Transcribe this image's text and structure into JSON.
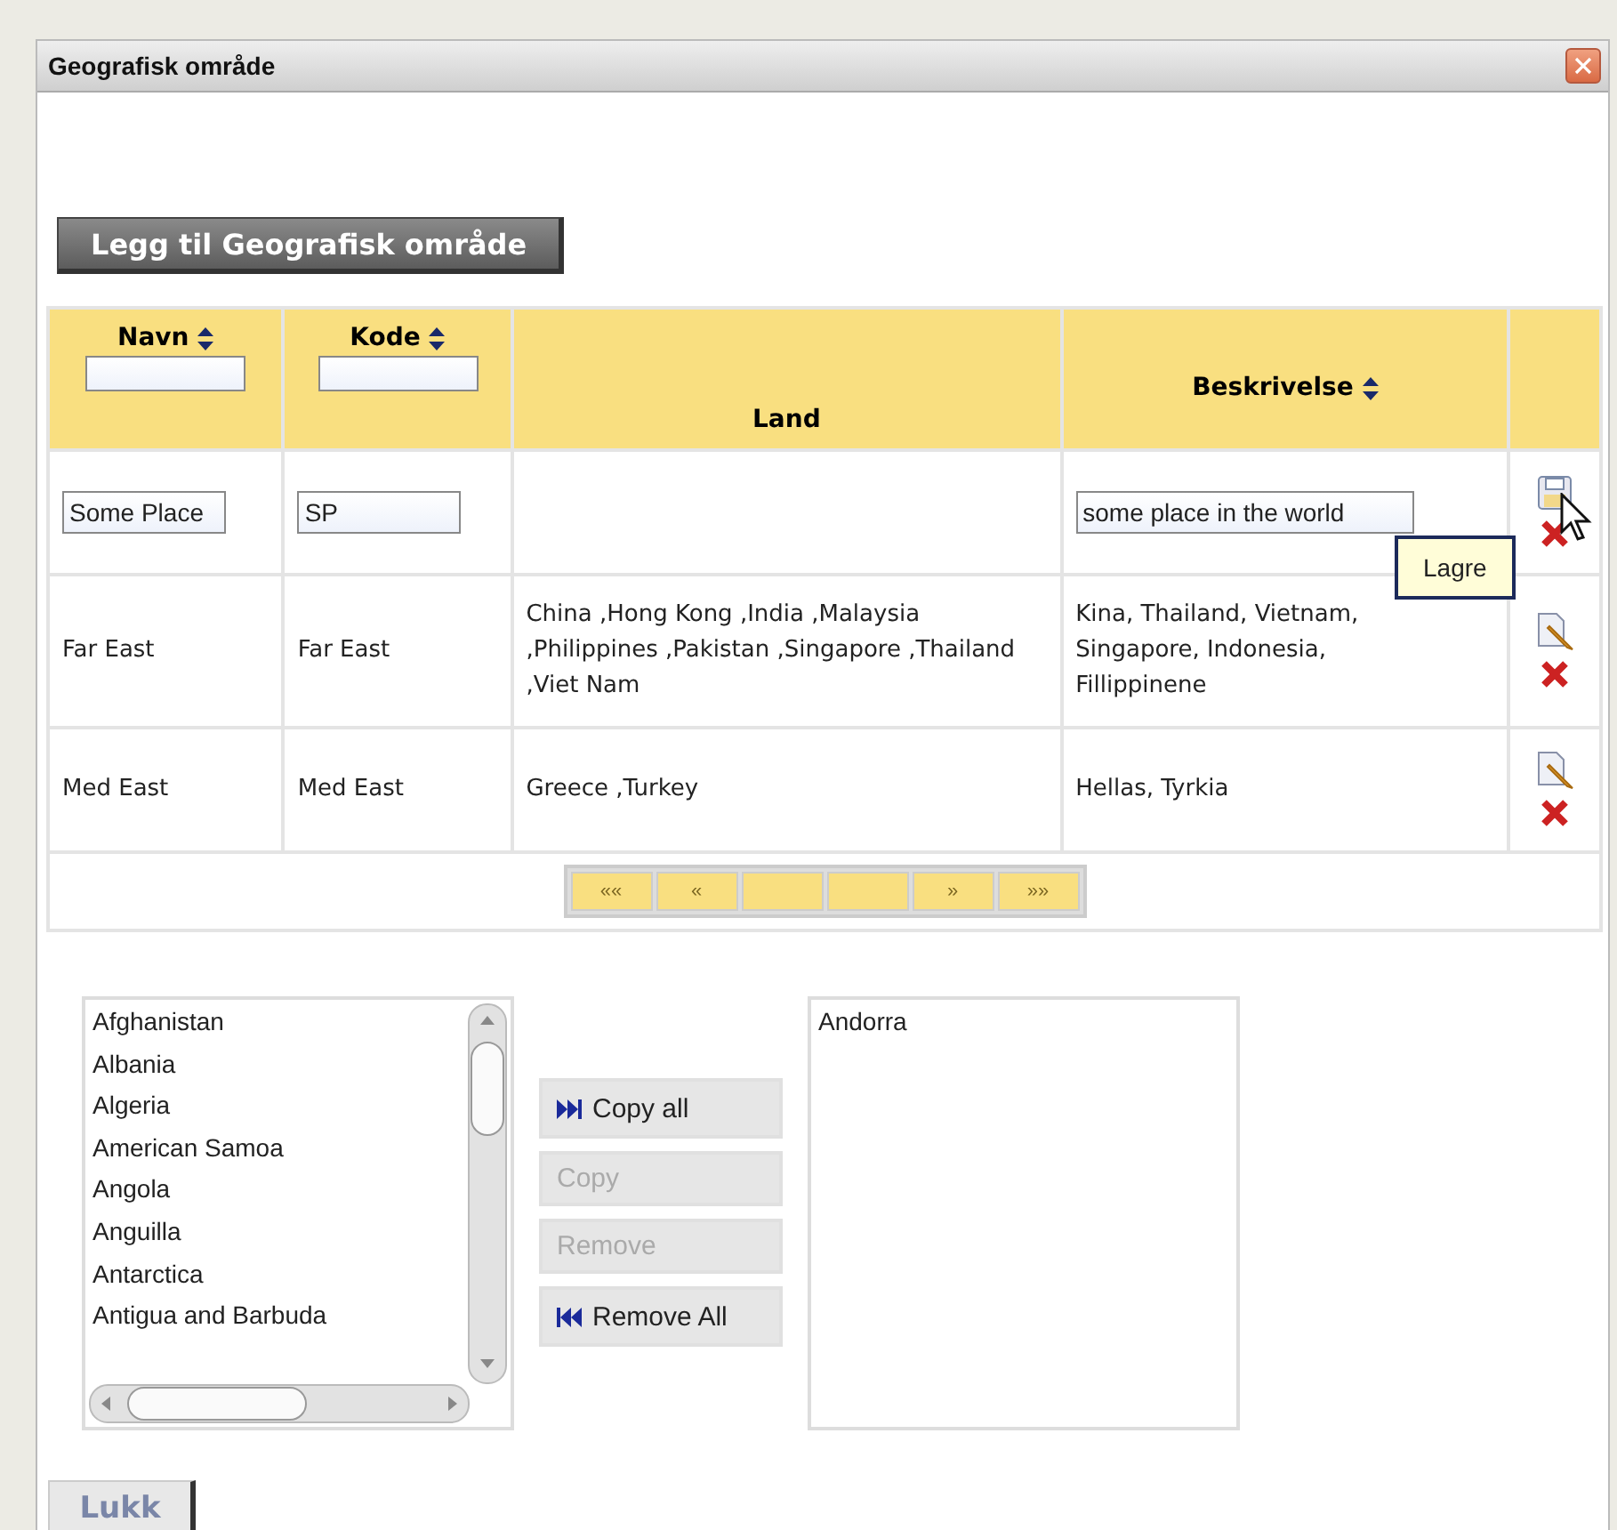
{
  "window": {
    "title": "Geografisk område"
  },
  "add_button": "Legg til Geografisk område",
  "table": {
    "columns": [
      {
        "label": "Navn",
        "sortable": true,
        "filter": true
      },
      {
        "label": "Kode",
        "sortable": true,
        "filter": true
      },
      {
        "label": "Land",
        "sortable": false,
        "filter": false
      },
      {
        "label": "Beskrivelse",
        "sortable": true,
        "filter": false
      }
    ],
    "rows": [
      {
        "kind": "edit",
        "navn": "Some Place",
        "kode": "SP",
        "beskrivelse": "some place in the world"
      },
      {
        "kind": "view",
        "navn": "Far East",
        "kode": "Far East",
        "land": "China ,Hong Kong ,India ,Malaysia ,Philippines ,Pakistan ,Singapore ,Thailand ,Viet Nam",
        "beskrivelse": "Kina, Thailand, Vietnam, Singapore, Indonesia, Fillippinene"
      },
      {
        "kind": "view",
        "navn": "Med East",
        "kode": "Med East",
        "land": "Greece ,Turkey",
        "beskrivelse": "Hellas, Tyrkia"
      }
    ],
    "pager": {
      "prev": [
        "««",
        "«"
      ],
      "next": [
        "»",
        "»»"
      ]
    }
  },
  "tooltip": "Lagre",
  "available": [
    "Afghanistan",
    "Albania",
    "Algeria",
    "American Samoa",
    "Angola",
    "Anguilla",
    "Antarctica",
    "Antigua and Barbuda"
  ],
  "transfer_buttons": [
    {
      "label": "Copy all",
      "kind": "all-forward",
      "disabled": false
    },
    {
      "label": "Copy",
      "kind": "plain",
      "disabled": true
    },
    {
      "label": "Remove",
      "kind": "plain",
      "disabled": true
    },
    {
      "label": "Remove All",
      "kind": "all-back",
      "disabled": false
    }
  ],
  "selected": [
    "Andorra"
  ],
  "close_button": "Lukk"
}
